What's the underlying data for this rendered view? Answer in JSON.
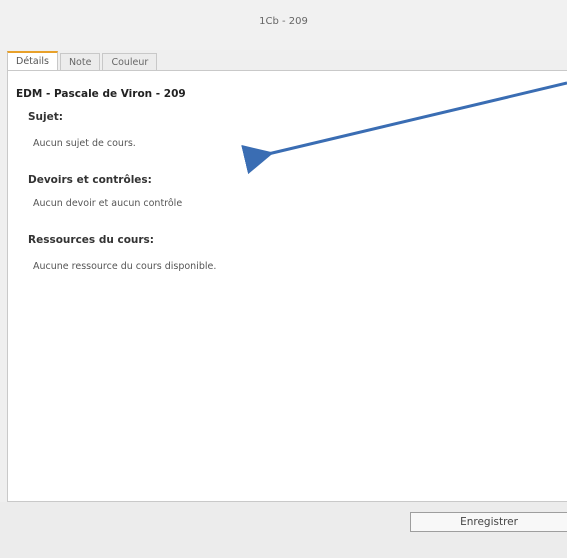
{
  "window": {
    "title": "1Cb - 209"
  },
  "tabs": [
    {
      "label": "Détails",
      "active": true
    },
    {
      "label": "Note",
      "active": false
    },
    {
      "label": "Couleur",
      "active": false
    }
  ],
  "details": {
    "course_title": "EDM - Pascale de Viron - 209",
    "sections": [
      {
        "heading": "Sujet:",
        "value": "Aucun sujet de cours."
      },
      {
        "heading": "Devoirs et contrôles:",
        "value": "Aucun devoir et aucun contrôle"
      },
      {
        "heading": "Ressources du cours:",
        "value": "Aucune ressource du cours disponible."
      }
    ]
  },
  "footer": {
    "save_label": "Enregistrer"
  },
  "colors": {
    "active_tab_accent": "#e8a12a",
    "arrow": "#3a6db3"
  },
  "annotation": {
    "icon": "arrow-icon"
  }
}
